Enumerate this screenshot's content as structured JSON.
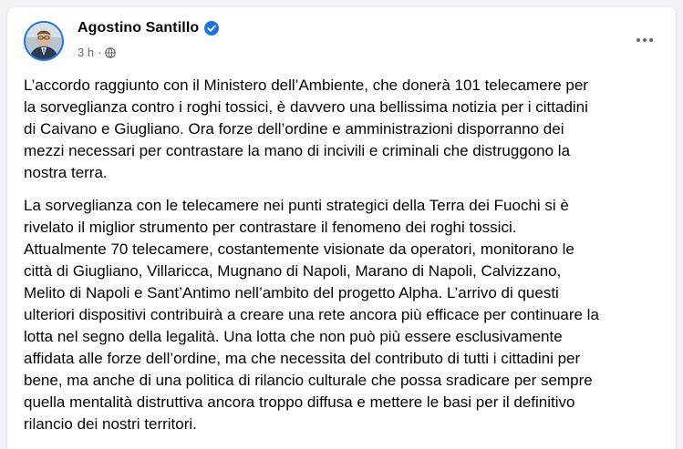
{
  "post": {
    "author": {
      "name": "Agostino Santillo",
      "verified": true
    },
    "timestamp": "3 h",
    "separator": "·",
    "audience_icon": "globe-icon",
    "menu_icon": "more-options-icon",
    "paragraphs": [
      "L’accordo raggiunto con il Ministero dell’Ambiente, che donerà 101 telecamere per\nla sorveglianza contro i roghi tossici, è davvero una bellissima notizia per i cittadini\ndi Caivano e Giugliano. Ora forze dell’ordine e amministrazioni disporranno dei\nmezzi necessari per contrastare la mano di incivili e criminali che distruggono la\nnostra terra.",
      "La sorveglianza con le telecamere nei punti strategici della Terra dei Fuochi si è\nrivelato il miglior strumento per contrastare il fenomeno dei roghi tossici.\nAttualmente 70 telecamere, costantemente visionate da operatori, monitorano le\ncittà di Giugliano, Villaricca, Mugnano di Napoli, Marano di Napoli, Calvizzano,\nMelito di Napoli e Sant’Antimo nell’ambito del progetto Alpha. L’arrivo di questi\nulteriori dispositivi contribuirà a creare una rete ancora più efficace per continuare la\nlotta nel segno della legalità. Una lotta che non può più essere esclusivamente\naffidata alle forze dell’ordine, ma che necessita del contributo di tutti i cittadini per\nbene, ma anche di una politica di rilancio culturale che possa sradicare per sempre\nquella mentalità distruttiva ancora troppo diffusa e mettere le basi per il definitivo\nrilancio dei nostri territori."
    ]
  },
  "colors": {
    "page_background": "#f0f2f5",
    "card_background": "#ffffff",
    "verified_badge": "#1b74e4",
    "secondary_text": "#65676b",
    "primary_text": "#050505"
  }
}
